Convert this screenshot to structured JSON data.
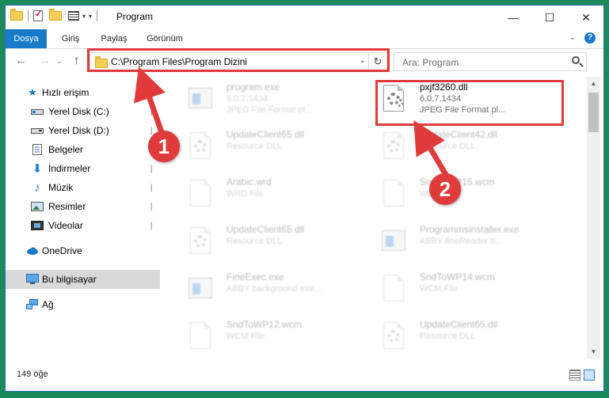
{
  "window": {
    "title": "Program"
  },
  "ribbon": {
    "tabs": [
      "Dosya",
      "Giriş",
      "Paylaş",
      "Görünüm"
    ]
  },
  "address": {
    "path": "C:\\Program Files\\Program Dizini"
  },
  "search": {
    "placeholder": "Ara: Program"
  },
  "sidebar": {
    "items": [
      {
        "label": "Hızlı erişim",
        "icon": "star-icon"
      },
      {
        "label": "Yerel Disk (C:)",
        "icon": "drive-icon",
        "pinned": true
      },
      {
        "label": "Yerel Disk (D:)",
        "icon": "drive-icon",
        "pinned": true
      },
      {
        "label": "Belgeler",
        "icon": "documents-icon",
        "pinned": true
      },
      {
        "label": "İndirmeler",
        "icon": "download-icon",
        "pinned": true
      },
      {
        "label": "Müzik",
        "icon": "music-icon",
        "pinned": true
      },
      {
        "label": "Resimler",
        "icon": "pictures-icon",
        "pinned": true
      },
      {
        "label": "Videolar",
        "icon": "videos-icon",
        "pinned": true
      },
      {
        "label": "OneDrive",
        "icon": "cloud-icon"
      },
      {
        "label": "Bu bilgisayar",
        "icon": "computer-icon",
        "selected": true
      },
      {
        "label": "Ağ",
        "icon": "network-icon"
      }
    ]
  },
  "files": [
    {
      "name": "program.exe",
      "line1": "6.0.7.1434",
      "line2": "JPEG File Format pl...",
      "icon": "exe-icon",
      "highlight": false
    },
    {
      "name": "pxjf3260.dll",
      "line1": "6.0.7.1434",
      "line2": "JPEG File Format pl...",
      "icon": "dll-gear-icon",
      "highlight": true
    },
    {
      "name": "UpdateClient65.dll",
      "line1": "Resource DLL",
      "line2": "",
      "icon": "dll-gear-icon",
      "highlight": false
    },
    {
      "name": "UpdateClient42.dll",
      "line1": "Resource DLL",
      "line2": "",
      "icon": "dll-gear-icon",
      "highlight": false
    },
    {
      "name": "Arabic.wrd",
      "line1": "WRD File",
      "line2": "",
      "icon": "file-icon",
      "highlight": false
    },
    {
      "name": "SndToWP15.wcm",
      "line1": "WCM File",
      "line2": "",
      "icon": "file-icon",
      "highlight": false
    },
    {
      "name": "UpdateClient65.dll",
      "line1": "Resource DLL",
      "line2": "",
      "icon": "dll-gear-icon",
      "highlight": false
    },
    {
      "name": "Programmsinstaller.exe",
      "line1": "ABBY fineReader tr...",
      "line2": "",
      "icon": "exe-icon",
      "highlight": false
    },
    {
      "name": "FineExec.exe",
      "line1": "ABBY background exe...",
      "line2": "",
      "icon": "exe-icon",
      "highlight": false
    },
    {
      "name": "SndToWP14.wcm",
      "line1": "WCM File",
      "line2": "",
      "icon": "file-icon",
      "highlight": false
    },
    {
      "name": "SndToWP12.wcm",
      "line1": "WCM File",
      "line2": "",
      "icon": "file-icon",
      "highlight": false
    },
    {
      "name": "UpdateClient65.dll",
      "line1": "Resource DLL",
      "line2": "",
      "icon": "dll-gear-icon",
      "highlight": false
    }
  ],
  "status": {
    "count": "149 öğe"
  },
  "annotations": {
    "step1": "1",
    "step2": "2",
    "color": "#e03b3b"
  }
}
